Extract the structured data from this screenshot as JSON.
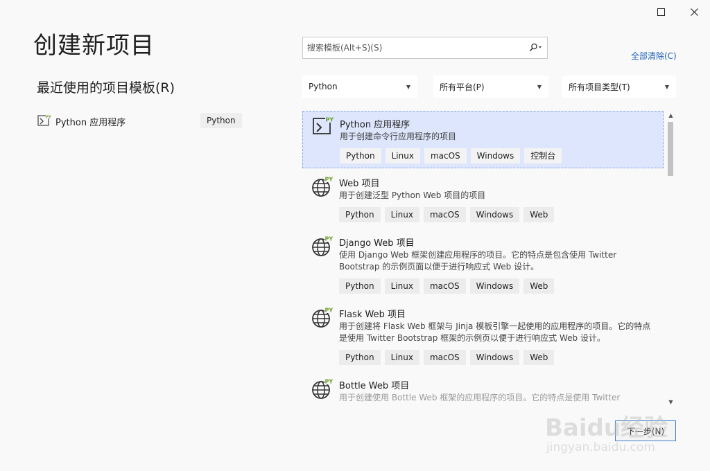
{
  "window": {
    "maximize_icon": "maximize-icon",
    "close_icon": "close-icon"
  },
  "page_title": "创建新项目",
  "recent": {
    "title": "最近使用的项目模板(R)",
    "items": [
      {
        "label": "Python 应用程序",
        "tag": "Python",
        "icon": "python-console-icon"
      }
    ]
  },
  "search": {
    "placeholder": "搜索模板(Alt+S)(S)",
    "value": "",
    "icon": "search-icon"
  },
  "clear_all": "全部清除(C)",
  "filters": {
    "language": "Python",
    "platform": "所有平台(P)",
    "project_type": "所有项目类型(T)"
  },
  "templates": [
    {
      "name": "Python 应用程序",
      "description": "用于创建命令行应用程序的项目",
      "tags": [
        "Python",
        "Linux",
        "macOS",
        "Windows",
        "控制台"
      ],
      "icon": "python-console-icon",
      "selected": true
    },
    {
      "name": "Web 项目",
      "description": "用于创建泛型 Python Web 项目的项目",
      "tags": [
        "Python",
        "Linux",
        "macOS",
        "Windows",
        "Web"
      ],
      "icon": "python-web-globe-icon",
      "selected": false
    },
    {
      "name": "Django Web 项目",
      "description": "使用 Django Web 框架创建应用程序的项目。它的特点是包含使用 Twitter Bootstrap 的示例页面以便于进行响应式 Web 设计。",
      "tags": [
        "Python",
        "Linux",
        "macOS",
        "Windows",
        "Web"
      ],
      "icon": "python-web-globe-icon",
      "selected": false
    },
    {
      "name": "Flask Web 项目",
      "description": "用于创建将 Flask Web 框架与 Jinja 模板引擎一起使用的应用程序的项目。它的特点是使用 Twitter Bootstrap 框架的示例页以便于进行响应式 Web 设计。",
      "tags": [
        "Python",
        "Linux",
        "macOS",
        "Windows",
        "Web"
      ],
      "icon": "python-web-globe-icon",
      "selected": false
    },
    {
      "name": "Bottle Web 项目",
      "description": "用于创建使用 Bottle Web 框架的应用程序的项目。它的特点是使用 Twitter",
      "tags": [],
      "icon": "python-web-globe-icon",
      "selected": false
    }
  ],
  "next_button": "下一步(N)",
  "watermark": {
    "line1": "Baidu经验",
    "line2": "jingyan.baidu.com"
  },
  "colors": {
    "selected_bg": "#dde6fc",
    "selected_border": "#8aa8e6",
    "link": "#1a5fb4",
    "python_green": "#6e9e2c",
    "button_border": "#3c7fc6"
  }
}
